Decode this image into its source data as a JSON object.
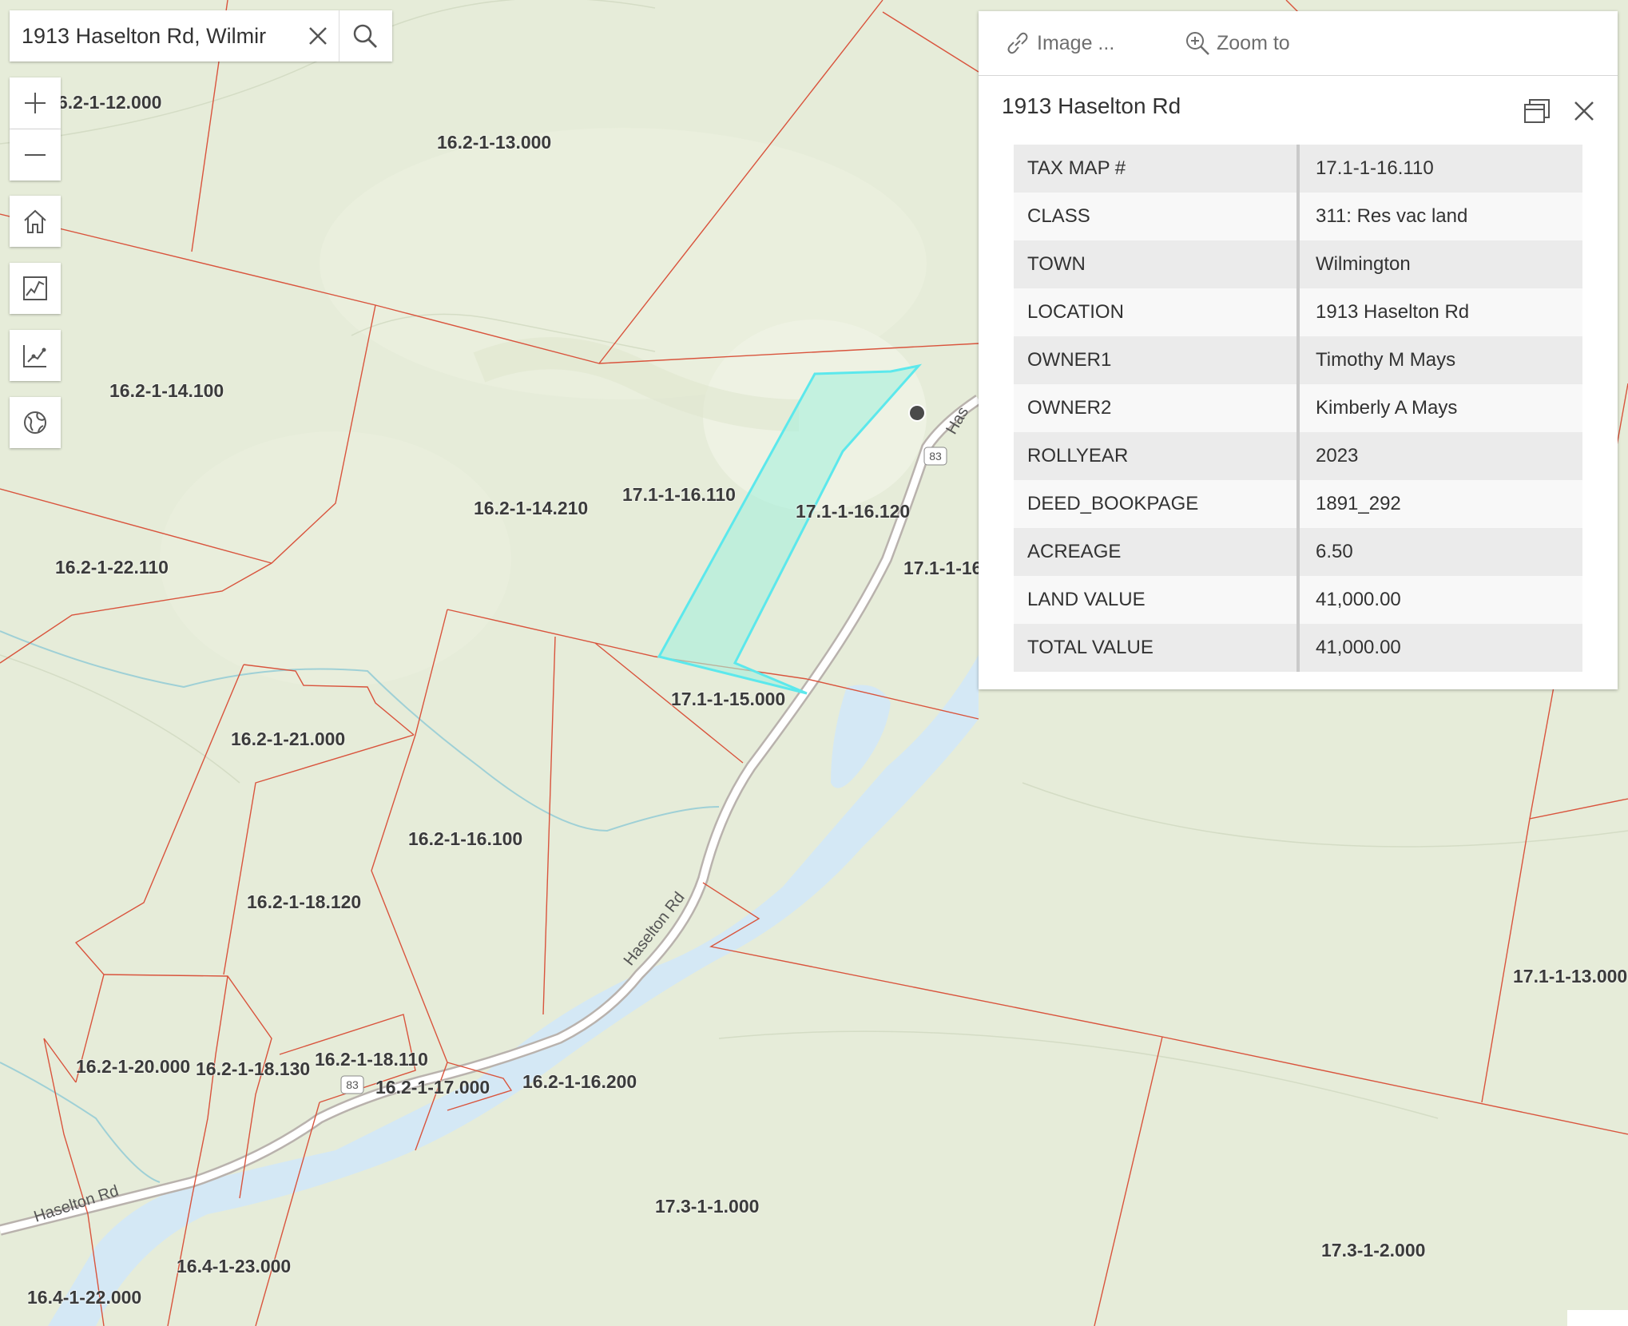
{
  "search": {
    "value": "1913 Haselton Rd, Wilmir"
  },
  "popup": {
    "actions": {
      "image": "Image ...",
      "zoom": "Zoom to"
    },
    "title": "1913 Haselton Rd",
    "attributes": [
      {
        "key": "TAX MAP #",
        "value": "17.1-1-16.110"
      },
      {
        "key": "CLASS",
        "value": "311: Res vac land"
      },
      {
        "key": "TOWN",
        "value": "Wilmington"
      },
      {
        "key": "LOCATION",
        "value": "1913 Haselton Rd"
      },
      {
        "key": "OWNER1",
        "value": "Timothy M Mays"
      },
      {
        "key": "OWNER2",
        "value": "Kimberly A Mays"
      },
      {
        "key": "ROLLYEAR",
        "value": "2023"
      },
      {
        "key": "DEED_BOOKPAGE",
        "value": "1891_292"
      },
      {
        "key": "ACREAGE",
        "value": "6.50"
      },
      {
        "key": "LAND VALUE",
        "value": "41,000.00"
      },
      {
        "key": "TOTAL VALUE",
        "value": "41,000.00"
      }
    ]
  },
  "map": {
    "parcels": [
      "6.2-1-12.000",
      "16.2-1-13.000",
      "16.2-1-14.100",
      "16.2-1-14.210",
      "17.1-1-16.110",
      "17.1-1-16.120",
      "17.1-1-16",
      "16.2-1-22.110",
      "17.1-1-15.000",
      "16.2-1-21.000",
      "16.2-1-16.100",
      "16.2-1-18.120",
      "16.2-1-20.000",
      "16.2-1-18.130",
      "16.2-1-18.110",
      "16.2-1-17.000",
      "16.2-1-16.200",
      "17.3-1-1.000",
      "16.4-1-23.000",
      "16.4-1-22.000",
      "17.3-1-2.000",
      "17.1-1-13.000"
    ],
    "road_name": "Haselton Rd",
    "route_shield": "83"
  },
  "colors": {
    "parcel_line": "#d9543d",
    "selected_fill": "#a6f0dc",
    "selected_outline": "#5ce8ec",
    "water": "#d4e8f5",
    "land": "#e6ecd9"
  }
}
